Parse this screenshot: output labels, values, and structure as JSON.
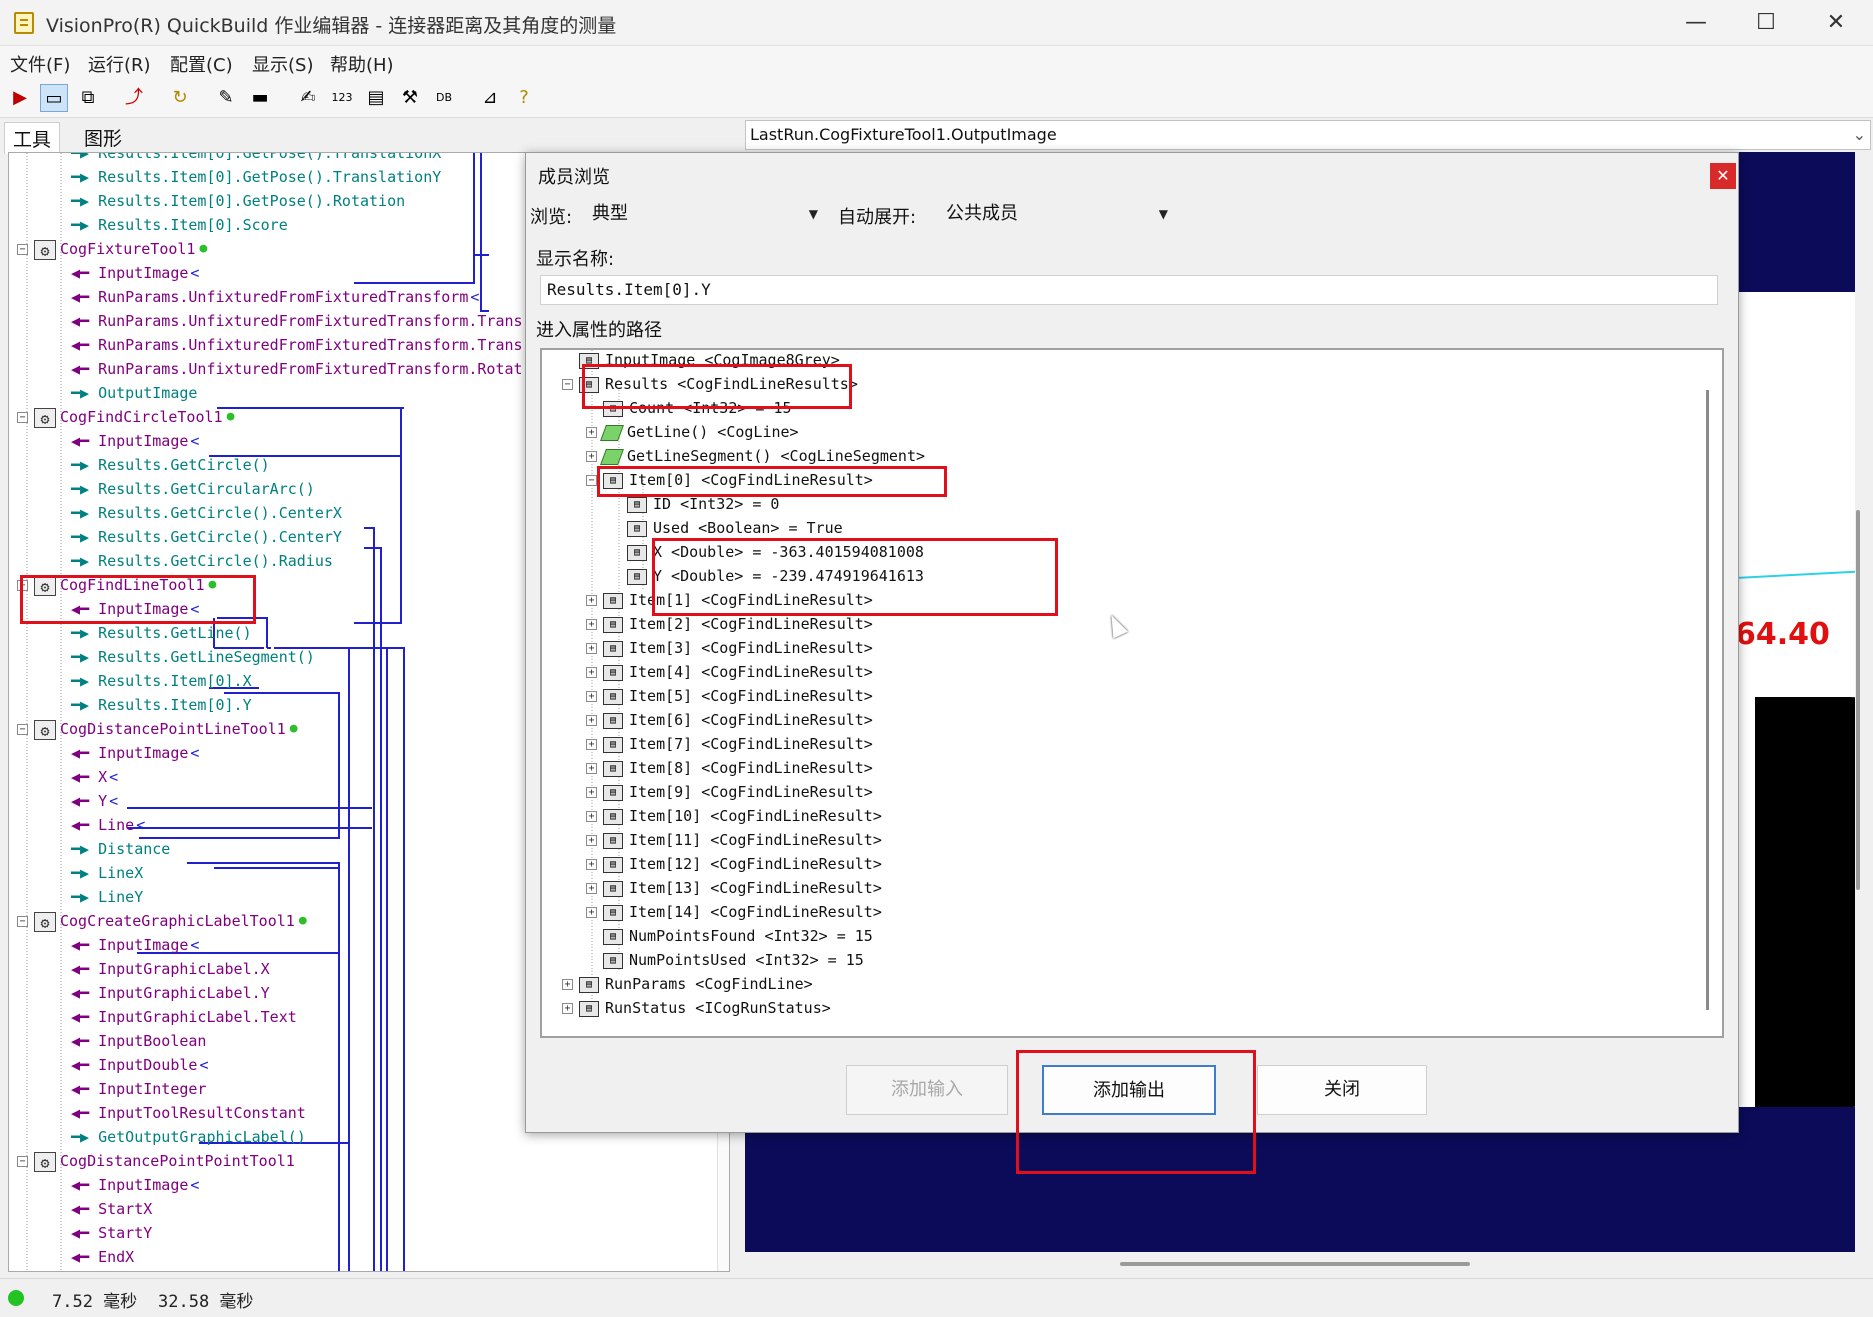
{
  "window": {
    "title": "VisionPro(R) QuickBuild 作业编辑器 - 连接器距离及其角度的测量",
    "controls": [
      "—",
      "☐",
      "✕"
    ]
  },
  "menu": [
    "文件(F)",
    "运行(R)",
    "配置(C)",
    "显示(S)",
    "帮助(H)"
  ],
  "toolbar_icons": [
    "run-icon",
    "display-icon",
    "copy-icon",
    "import-icon",
    "refresh-icon",
    "brush-icon",
    "link-icon",
    "edit-icon",
    "counter-icon",
    "terminal-icon",
    "tools-icon",
    "db-icon",
    "chart-icon",
    "help-icon"
  ],
  "tabs": {
    "tools": "工具",
    "graphics": "图形"
  },
  "tree": [
    {
      "indent": 2,
      "arrow": "out",
      "text": "Results.Item[0].GetPose().TranslationX"
    },
    {
      "indent": 2,
      "arrow": "out",
      "text": "Results.Item[0].GetPose().TranslationY"
    },
    {
      "indent": 2,
      "arrow": "out",
      "text": "Results.Item[0].GetPose().Rotation"
    },
    {
      "indent": 2,
      "arrow": "out",
      "text": "Results.Item[0].Score"
    },
    {
      "indent": 1,
      "arrow": "node",
      "text": "CogFixtureTool1",
      "dot": true
    },
    {
      "indent": 2,
      "arrow": "in",
      "text": "InputImage",
      "link": true
    },
    {
      "indent": 2,
      "arrow": "in",
      "text": "RunParams.UnfixturedFromFixturedTransform",
      "link": true
    },
    {
      "indent": 2,
      "arrow": "in",
      "text": "RunParams.UnfixturedFromFixturedTransform.Trans"
    },
    {
      "indent": 2,
      "arrow": "in",
      "text": "RunParams.UnfixturedFromFixturedTransform.Trans"
    },
    {
      "indent": 2,
      "arrow": "in",
      "text": "RunParams.UnfixturedFromFixturedTransform.Rotat"
    },
    {
      "indent": 2,
      "arrow": "out",
      "text": "OutputImage"
    },
    {
      "indent": 1,
      "arrow": "node",
      "text": "CogFindCircleTool1",
      "dot": true
    },
    {
      "indent": 2,
      "arrow": "in",
      "text": "InputImage",
      "link": true
    },
    {
      "indent": 2,
      "arrow": "out",
      "text": "Results.GetCircle()"
    },
    {
      "indent": 2,
      "arrow": "out",
      "text": "Results.GetCircularArc()"
    },
    {
      "indent": 2,
      "arrow": "out",
      "text": "Results.GetCircle().CenterX"
    },
    {
      "indent": 2,
      "arrow": "out",
      "text": "Results.GetCircle().CenterY"
    },
    {
      "indent": 2,
      "arrow": "out",
      "text": "Results.GetCircle().Radius"
    },
    {
      "indent": 1,
      "arrow": "node",
      "text": "CogFindLineTool1",
      "dot": true
    },
    {
      "indent": 2,
      "arrow": "in",
      "text": "InputImage",
      "link": true
    },
    {
      "indent": 2,
      "arrow": "out",
      "text": "Results.GetLine()"
    },
    {
      "indent": 2,
      "arrow": "out",
      "text": "Results.GetLineSegment()"
    },
    {
      "indent": 2,
      "arrow": "out",
      "text": "Results.Item[0].X"
    },
    {
      "indent": 2,
      "arrow": "out",
      "text": "Results.Item[0].Y"
    },
    {
      "indent": 1,
      "arrow": "node",
      "text": "CogDistancePointLineTool1",
      "dot": true
    },
    {
      "indent": 2,
      "arrow": "in",
      "text": "InputImage",
      "link": true
    },
    {
      "indent": 2,
      "arrow": "in",
      "text": "X",
      "link": true
    },
    {
      "indent": 2,
      "arrow": "in",
      "text": "Y",
      "link": true
    },
    {
      "indent": 2,
      "arrow": "in",
      "text": "Line",
      "link": true
    },
    {
      "indent": 2,
      "arrow": "out",
      "text": "Distance"
    },
    {
      "indent": 2,
      "arrow": "out",
      "text": "LineX"
    },
    {
      "indent": 2,
      "arrow": "out",
      "text": "LineY"
    },
    {
      "indent": 1,
      "arrow": "node",
      "text": "CogCreateGraphicLabelTool1",
      "dot": true
    },
    {
      "indent": 2,
      "arrow": "in",
      "text": "InputImage",
      "link": true
    },
    {
      "indent": 2,
      "arrow": "in",
      "text": "InputGraphicLabel.X"
    },
    {
      "indent": 2,
      "arrow": "in",
      "text": "InputGraphicLabel.Y"
    },
    {
      "indent": 2,
      "arrow": "in",
      "text": "InputGraphicLabel.Text"
    },
    {
      "indent": 2,
      "arrow": "in",
      "text": "InputBoolean"
    },
    {
      "indent": 2,
      "arrow": "in",
      "text": "InputDouble",
      "link": true
    },
    {
      "indent": 2,
      "arrow": "in",
      "text": "InputInteger"
    },
    {
      "indent": 2,
      "arrow": "in",
      "text": "InputToolResultConstant"
    },
    {
      "indent": 2,
      "arrow": "out",
      "text": "GetOutputGraphicLabel()"
    },
    {
      "indent": 1,
      "arrow": "node",
      "text": "CogDistancePointPointTool1",
      "dot": false
    },
    {
      "indent": 2,
      "arrow": "in",
      "text": "InputImage",
      "link": true
    },
    {
      "indent": 2,
      "arrow": "in",
      "text": "StartX"
    },
    {
      "indent": 2,
      "arrow": "in",
      "text": "StartY"
    },
    {
      "indent": 2,
      "arrow": "in",
      "text": "EndX"
    }
  ],
  "status": {
    "time1": "7.52 毫秒",
    "time2": "32.58 毫秒"
  },
  "image_panel": {
    "combo": "LastRun.CogFixtureTool1.OutputImage",
    "label": "64.40"
  },
  "dialog": {
    "title": "成员浏览",
    "browse_label": "浏览:",
    "browse_value": "典型",
    "auto_expand_label": "自动展开:",
    "auto_expand_value": "公共成员",
    "display_name_label": "显示名称:",
    "display_name_value": "Results.Item[0].Y",
    "path_label": "进入属性的路径",
    "path_tree": [
      {
        "level": 1,
        "exp": "",
        "icon": "prop",
        "text": "InputImage <CogImage8Grey>"
      },
      {
        "level": 1,
        "exp": "-",
        "icon": "prop",
        "text": "Results <CogFindLineResults>"
      },
      {
        "level": 2,
        "exp": "",
        "icon": "prop",
        "text": "Count <Int32> = 15"
      },
      {
        "level": 2,
        "exp": "+",
        "icon": "method",
        "text": "GetLine() <CogLine>"
      },
      {
        "level": 2,
        "exp": "+",
        "icon": "method",
        "text": "GetLineSegment() <CogLineSegment>"
      },
      {
        "level": 2,
        "exp": "-",
        "icon": "prop",
        "text": "Item[0] <CogFindLineResult>"
      },
      {
        "level": 3,
        "exp": "",
        "icon": "prop",
        "text": "ID <Int32> = 0"
      },
      {
        "level": 3,
        "exp": "",
        "icon": "prop",
        "text": "Used <Boolean> = True"
      },
      {
        "level": 3,
        "exp": "",
        "icon": "prop",
        "text": "X <Double> = -363.401594081008"
      },
      {
        "level": 3,
        "exp": "",
        "icon": "prop",
        "text": "Y <Double> = -239.474919641613"
      },
      {
        "level": 2,
        "exp": "+",
        "icon": "prop",
        "text": "Item[1] <CogFindLineResult>"
      },
      {
        "level": 2,
        "exp": "+",
        "icon": "prop",
        "text": "Item[2] <CogFindLineResult>"
      },
      {
        "level": 2,
        "exp": "+",
        "icon": "prop",
        "text": "Item[3] <CogFindLineResult>"
      },
      {
        "level": 2,
        "exp": "+",
        "icon": "prop",
        "text": "Item[4] <CogFindLineResult>"
      },
      {
        "level": 2,
        "exp": "+",
        "icon": "prop",
        "text": "Item[5] <CogFindLineResult>"
      },
      {
        "level": 2,
        "exp": "+",
        "icon": "prop",
        "text": "Item[6] <CogFindLineResult>"
      },
      {
        "level": 2,
        "exp": "+",
        "icon": "prop",
        "text": "Item[7] <CogFindLineResult>"
      },
      {
        "level": 2,
        "exp": "+",
        "icon": "prop",
        "text": "Item[8] <CogFindLineResult>"
      },
      {
        "level": 2,
        "exp": "+",
        "icon": "prop",
        "text": "Item[9] <CogFindLineResult>"
      },
      {
        "level": 2,
        "exp": "+",
        "icon": "prop",
        "text": "Item[10] <CogFindLineResult>"
      },
      {
        "level": 2,
        "exp": "+",
        "icon": "prop",
        "text": "Item[11] <CogFindLineResult>"
      },
      {
        "level": 2,
        "exp": "+",
        "icon": "prop",
        "text": "Item[12] <CogFindLineResult>"
      },
      {
        "level": 2,
        "exp": "+",
        "icon": "prop",
        "text": "Item[13] <CogFindLineResult>"
      },
      {
        "level": 2,
        "exp": "+",
        "icon": "prop",
        "text": "Item[14] <CogFindLineResult>"
      },
      {
        "level": 2,
        "exp": "",
        "icon": "prop",
        "text": "NumPointsFound <Int32> = 15"
      },
      {
        "level": 2,
        "exp": "",
        "icon": "prop",
        "text": "NumPointsUsed <Int32> = 15"
      },
      {
        "level": 1,
        "exp": "+",
        "icon": "prop",
        "text": "RunParams <CogFindLine>"
      },
      {
        "level": 1,
        "exp": "+",
        "icon": "prop",
        "text": "RunStatus <ICogRunStatus>"
      }
    ],
    "buttons": {
      "add_input": "添加输入",
      "add_output": "添加输出",
      "close": "关闭"
    }
  },
  "colors": {
    "output_arrow": "#008080",
    "input_arrow": "#800080",
    "link_line": "#2020d0",
    "highlight": "#e0101a",
    "image_bg": "#0b0b5a"
  }
}
